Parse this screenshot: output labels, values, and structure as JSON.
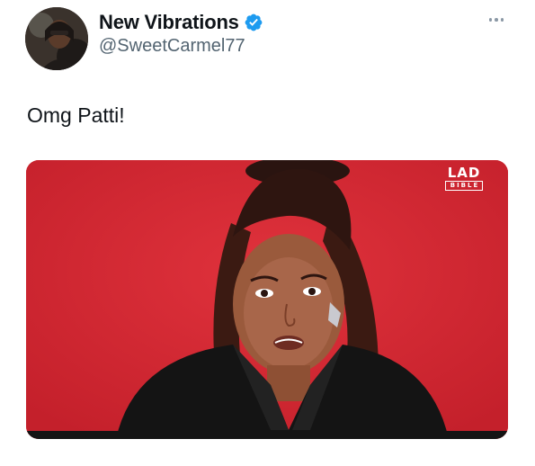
{
  "author": {
    "display_name": "New Vibrations",
    "handle": "@SweetCarmel77",
    "verified": true,
    "avatar_icon": "profile-photo-avatar"
  },
  "menu": {
    "icon": "more-options-icon"
  },
  "tweet": {
    "text": "Omg Patti!"
  },
  "media": {
    "type": "video-still",
    "background_color": "#d62a35",
    "watermark": {
      "top": "LAD",
      "bottom": "BIBLE"
    }
  },
  "colors": {
    "verified_badge": "#1d9bf0",
    "handle_text": "#536471",
    "primary_text": "#0f1419"
  }
}
